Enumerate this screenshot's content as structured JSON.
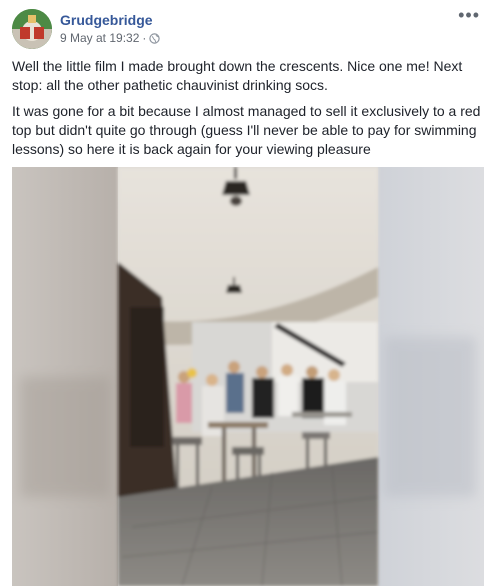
{
  "post": {
    "author": "Grudgebridge",
    "timestamp": "9 May at 19:32",
    "separator": "·",
    "privacy_icon": "globe-icon",
    "more_label": "•••",
    "paragraphs": [
      "Well the little film I made brought down the crescents. Nice one me! Next stop: all the other pathetic chauvinist drinking socs.",
      "It was gone for a bit because I almost managed to sell it exclusively to a red top but didn't quite go through (guess I'll never be able to pay for swimming lessons) so here it is back again for your viewing pleasure"
    ]
  },
  "colors": {
    "author_link": "#365899",
    "meta_text": "#616770",
    "body_text": "#1d2129"
  }
}
